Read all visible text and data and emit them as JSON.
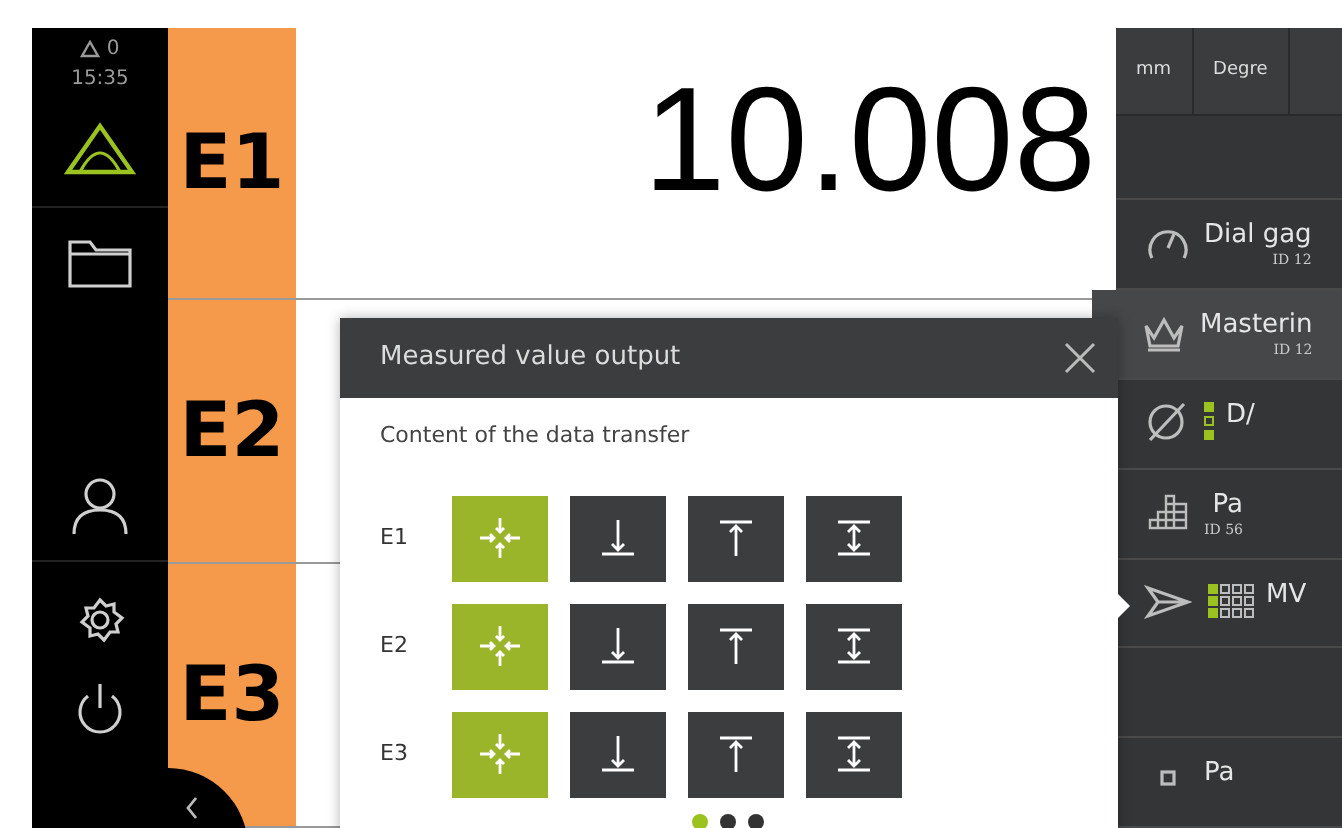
{
  "status": {
    "warnings": "0",
    "time": "15:35"
  },
  "nav": [
    {
      "kind": "measure",
      "selected": true
    },
    {
      "kind": "folder",
      "selected": false
    },
    {
      "kind": "user",
      "selected": false
    },
    {
      "kind": "settings",
      "selected": false
    },
    {
      "kind": "power",
      "selected": false
    }
  ],
  "channels": [
    {
      "label": "E1",
      "value": "10.008"
    },
    {
      "label": "E2"
    },
    {
      "label": "E3"
    }
  ],
  "units": [
    {
      "label": "mm"
    },
    {
      "label": "Degre"
    }
  ],
  "tools": [
    {
      "kind": "dial",
      "name": "Dial gag",
      "id": "ID 12",
      "selected": false
    },
    {
      "kind": "crown",
      "name": "Masterin",
      "id": "ID 12",
      "selected": true
    },
    {
      "kind": "diameter",
      "name": "D/",
      "selected": false
    },
    {
      "kind": "grid",
      "name": "Pa",
      "id": "ID 56",
      "selected": false
    },
    {
      "kind": "send",
      "name": "MV",
      "selected": false,
      "pointer": true
    },
    {
      "kind": "empty",
      "selected": false
    },
    {
      "kind": "square",
      "name": "Pa",
      "selected": false
    }
  ],
  "dialog": {
    "title": "Measured value output",
    "subtitle": "Content of the data transfer",
    "rows": [
      {
        "label": "E1",
        "options": [
          {
            "kind": "center",
            "selected": true
          },
          {
            "kind": "down",
            "selected": false
          },
          {
            "kind": "up",
            "selected": false
          },
          {
            "kind": "span",
            "selected": false
          }
        ]
      },
      {
        "label": "E2",
        "options": [
          {
            "kind": "center",
            "selected": true
          },
          {
            "kind": "down",
            "selected": false
          },
          {
            "kind": "up",
            "selected": false
          },
          {
            "kind": "span",
            "selected": false
          }
        ]
      },
      {
        "label": "E3",
        "options": [
          {
            "kind": "center",
            "selected": true
          },
          {
            "kind": "down",
            "selected": false
          },
          {
            "kind": "up",
            "selected": false
          },
          {
            "kind": "span",
            "selected": false
          }
        ]
      }
    ],
    "pages": [
      {
        "selected": true
      },
      {
        "selected": false
      },
      {
        "selected": false
      }
    ]
  }
}
